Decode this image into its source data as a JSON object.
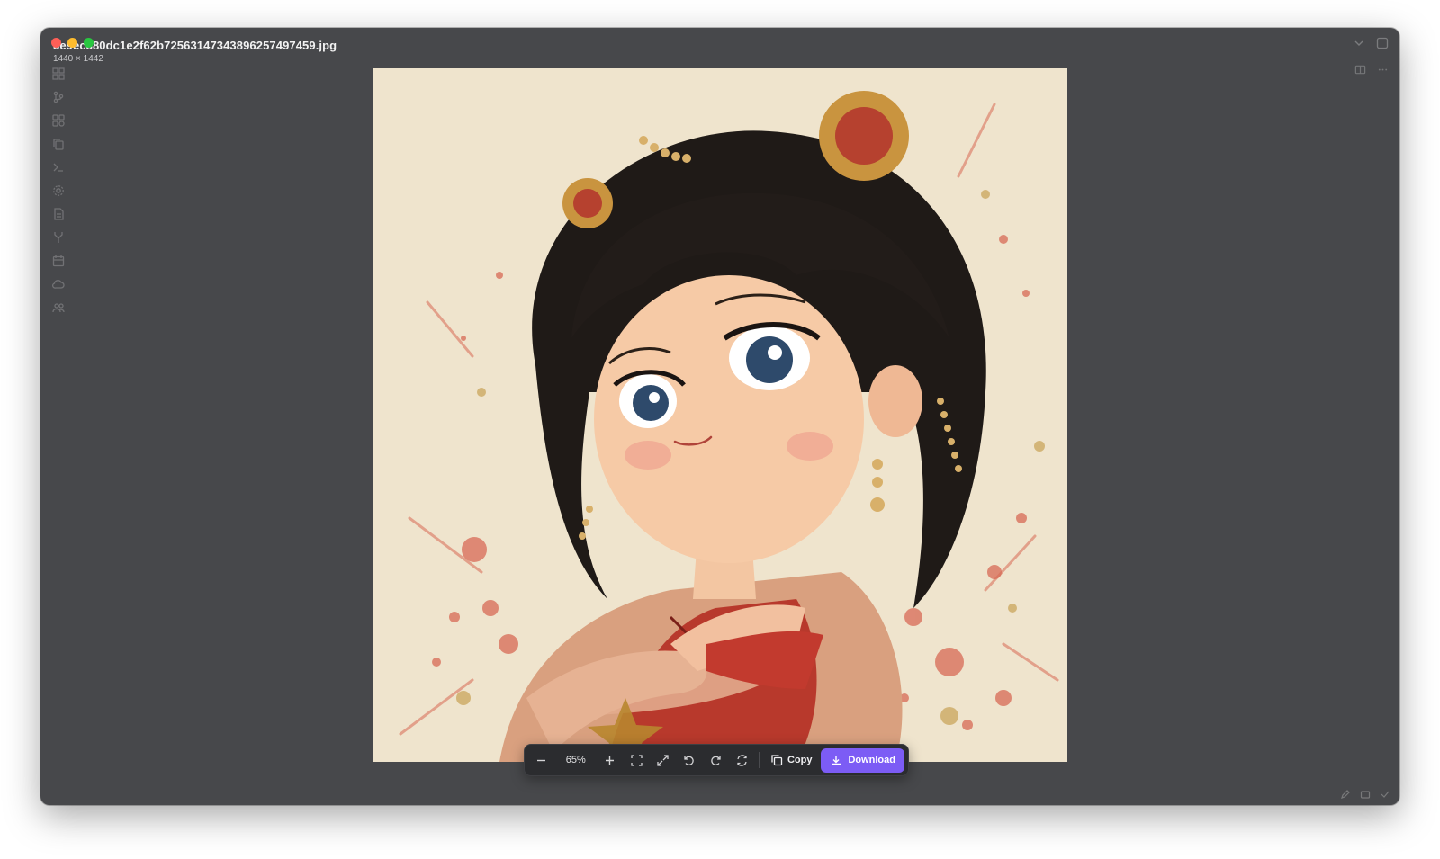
{
  "window": {
    "title": "3e9ec880dc1e2f62b72563147343896257497459.jpg",
    "dimensions": "1440 × 1442"
  },
  "sidebar": {
    "icons": [
      "grid-icon",
      "branch-icon",
      "extensions-icon",
      "copy-icon",
      "terminal-icon",
      "settings-icon",
      "document-icon",
      "merge-icon",
      "calendar-icon",
      "cloud-icon",
      "users-icon"
    ]
  },
  "toolbar": {
    "zoom": "65%",
    "copy_label": "Copy",
    "download_label": "Download"
  },
  "colors": {
    "window_bg": "#47484b",
    "toolbar_bg": "#2b2c2f",
    "accent": "#7c5cf5"
  },
  "image": {
    "subject": "illustration",
    "bg_color": "#efe4cd"
  }
}
